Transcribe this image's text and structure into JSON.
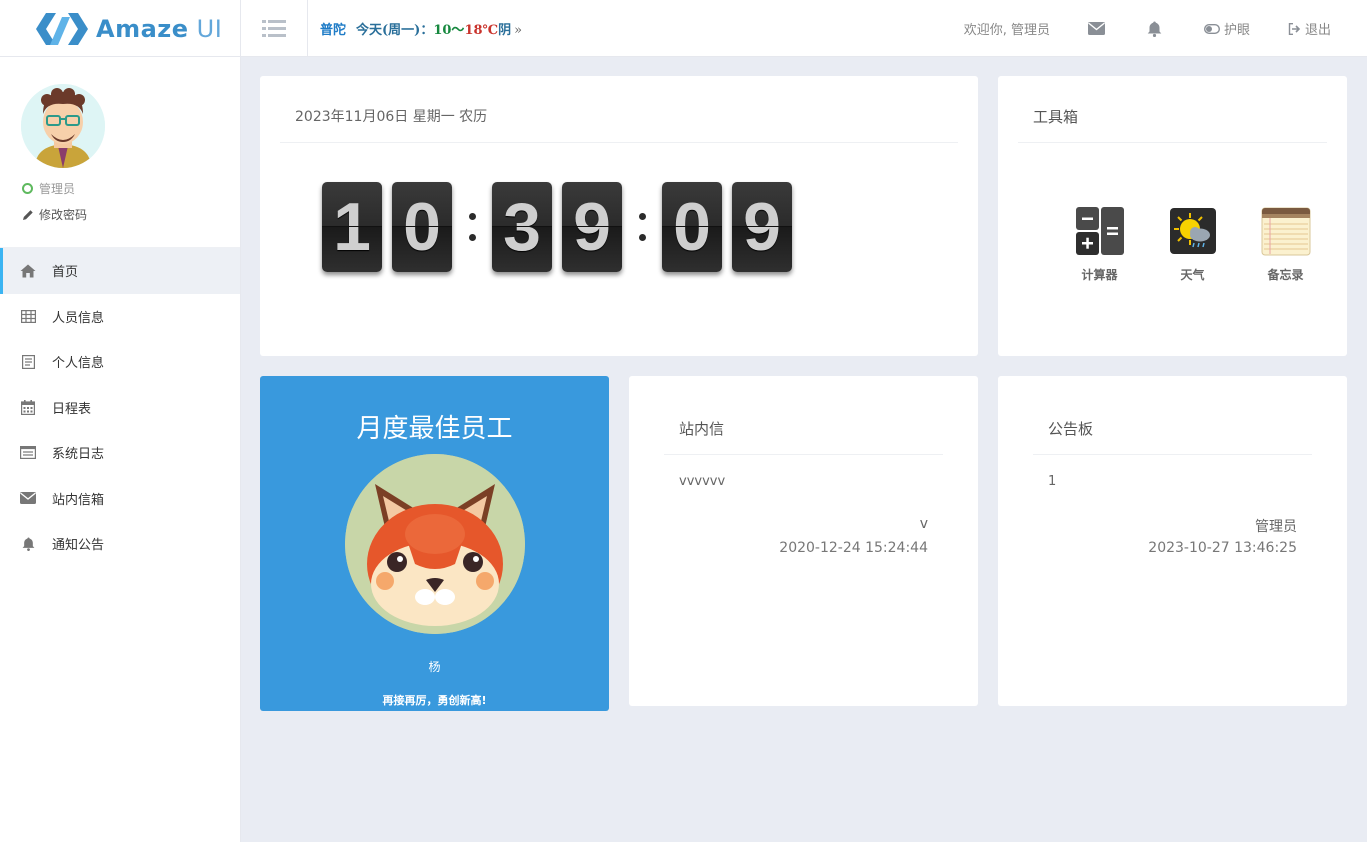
{
  "header": {
    "logo_text_a": "Amaze",
    "logo_text_b": "UI",
    "weather": {
      "city": "普陀",
      "today_prefix": "今天(周一)：",
      "temp_low": "10",
      "temp_sep": "～",
      "temp_high": "18",
      "unit": "℃",
      "condition": "阴",
      "more": "»"
    },
    "welcome": "欢迎你, 管理员",
    "eye_care": "护眼",
    "logout": "退出"
  },
  "sidebar": {
    "user_role": "管理员",
    "change_password": "修改密码",
    "items": [
      {
        "label": "首页",
        "icon": "home-icon",
        "active": true
      },
      {
        "label": "人员信息",
        "icon": "table-icon"
      },
      {
        "label": "个人信息",
        "icon": "profile-card-icon"
      },
      {
        "label": "日程表",
        "icon": "calendar-icon"
      },
      {
        "label": "系统日志",
        "icon": "log-icon"
      },
      {
        "label": "站内信箱",
        "icon": "envelope-icon"
      },
      {
        "label": "通知公告",
        "icon": "bell-icon"
      }
    ]
  },
  "clock": {
    "date_line": "2023年11月06日 星期一 农历",
    "digits": [
      "1",
      "0",
      "3",
      "9",
      "0",
      "9"
    ]
  },
  "toolbox": {
    "title": "工具箱",
    "tools": [
      {
        "label": "计算器",
        "icon": "calculator-icon"
      },
      {
        "label": "天气",
        "icon": "weather-icon"
      },
      {
        "label": "备忘录",
        "icon": "notepad-icon"
      }
    ]
  },
  "employee": {
    "title": "月度最佳员工",
    "name": "杨",
    "motto": "再接再厉，勇创新高!"
  },
  "mail": {
    "title": "站内信",
    "body": "vvvvvv",
    "sender": "v",
    "time": "2020-12-24 15:24:44"
  },
  "notice": {
    "title": "公告板",
    "body": "1",
    "sender": "管理员",
    "time": "2023-10-27 13:46:25"
  },
  "colors": {
    "accent": "#3bb4f2",
    "employee_bg": "#3999dd",
    "page_bg": "#e9ecf3"
  }
}
